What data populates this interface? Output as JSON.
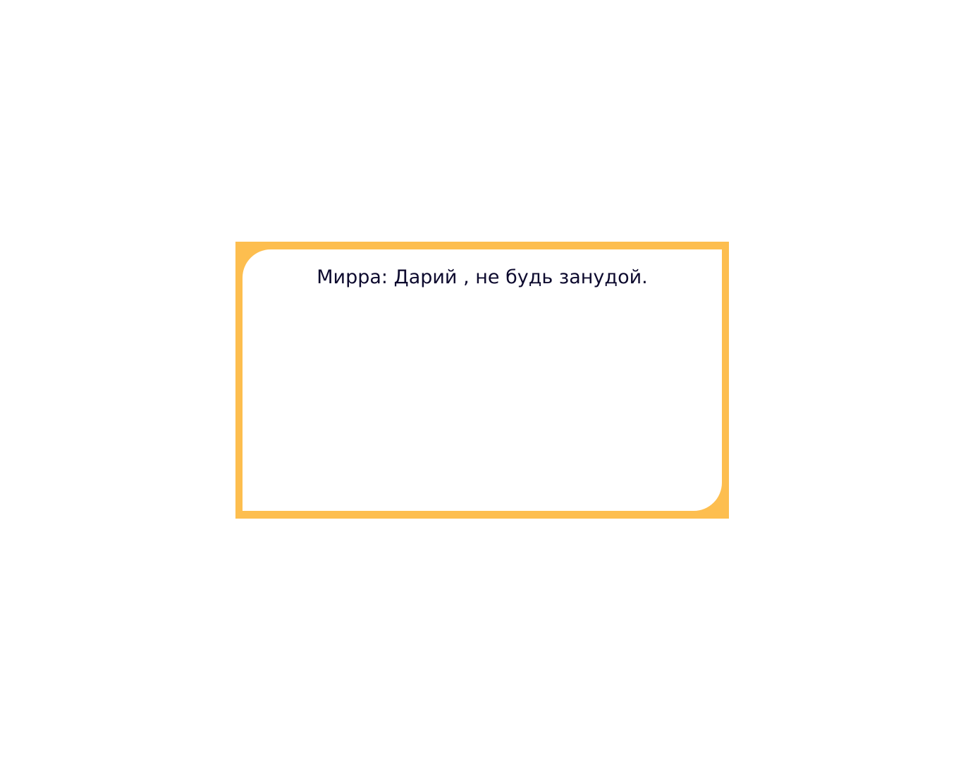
{
  "dialog": {
    "text": "Мирра: Дарий , не будь занудой."
  },
  "colors": {
    "frame": "#FDBE4F",
    "panel": "#FFFFFF",
    "text": "#0D0A2E"
  }
}
